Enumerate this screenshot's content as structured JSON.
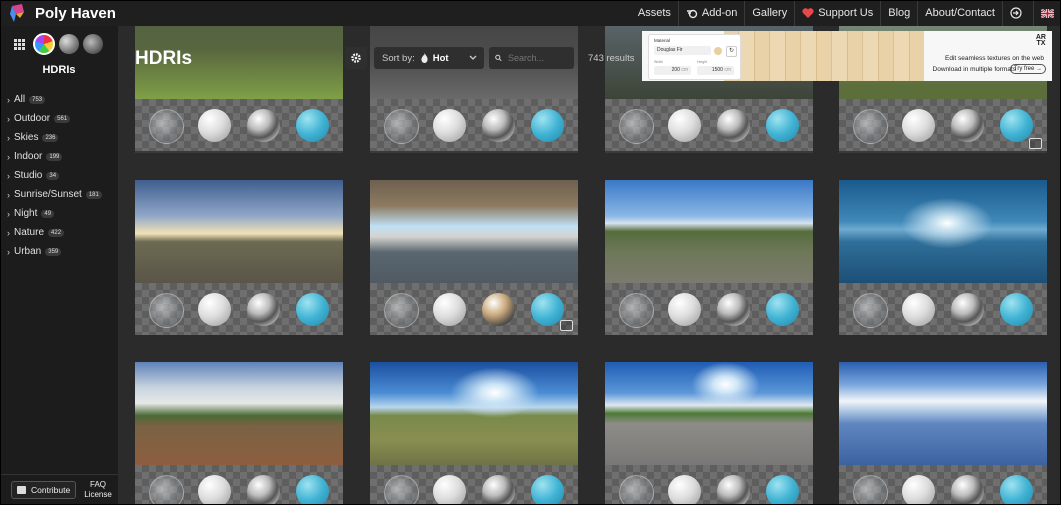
{
  "header": {
    "brand": "Poly Haven",
    "nav": [
      {
        "label": "Assets",
        "icon": ""
      },
      {
        "label": "Add-on",
        "icon": "blender-icon"
      },
      {
        "label": "Gallery",
        "icon": ""
      },
      {
        "label": "Support Us",
        "icon": "heart-icon"
      },
      {
        "label": "Blog",
        "icon": ""
      },
      {
        "label": "About/Contact",
        "icon": ""
      }
    ],
    "login_icon": "login-icon",
    "language_icon": "uk-flag-icon"
  },
  "sidebar": {
    "title": "HDRIs",
    "type_icons": [
      "grid-icon",
      "hdri-icon",
      "texture-icon",
      "model-icon"
    ],
    "categories": [
      {
        "label": "All",
        "count": "753"
      },
      {
        "label": "Outdoor",
        "count": "561"
      },
      {
        "label": "Skies",
        "count": "236"
      },
      {
        "label": "Indoor",
        "count": "199"
      },
      {
        "label": "Studio",
        "count": "34"
      },
      {
        "label": "Sunrise/Sunset",
        "count": "181"
      },
      {
        "label": "Night",
        "count": "49"
      },
      {
        "label": "Nature",
        "count": "422"
      },
      {
        "label": "Urban",
        "count": "359"
      }
    ],
    "contribute_label": "Contribute",
    "faq_label": "FAQ",
    "license_label": "License"
  },
  "toolbar": {
    "page_title": "HDRIs",
    "sort_label": "Sort by:",
    "sort_value": "Hot",
    "search_placeholder": "Search...",
    "results": "743 results"
  },
  "ad": {
    "logo_top": "AR",
    "logo_bottom": "TX",
    "panel_title": "Material",
    "panel_value": "Douglas Fir",
    "width_label": "Width",
    "height_label": "Height",
    "width_value": "200",
    "width_unit": "cm",
    "height_value": "1500",
    "height_unit": "cm",
    "line1": "Edit seamless textures on the web",
    "line2": "Download in multiple formats",
    "button": "Try free →"
  },
  "colors": {
    "background": "#2b2b2b",
    "sidebar": "#1c1c1c",
    "topbar": "#1f1f1f",
    "accent_ball": "#40b3d4"
  }
}
